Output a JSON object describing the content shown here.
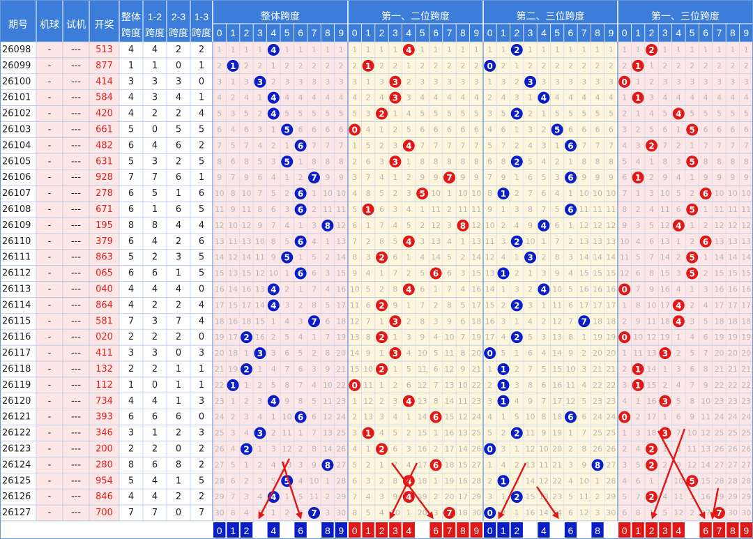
{
  "chart_data": {
    "type": "table",
    "headers": {
      "period": "期号",
      "machine": "机球",
      "trial": "试机",
      "draw": "开奖",
      "overall_span_l1": "整体",
      "overall_span_l2": "跨度",
      "span12_l1": "1-2",
      "span12_l2": "跨度",
      "span23_l1": "2-3",
      "span23_l2": "跨度",
      "span13_l1": "1-3",
      "span13_l2": "跨度",
      "groups": [
        "整体跨度",
        "第一、二位跨度",
        "第二、三位跨度",
        "第一、三位跨度"
      ],
      "digits": [
        "0",
        "1",
        "2",
        "3",
        "4",
        "5",
        "6",
        "7",
        "8",
        "9"
      ]
    },
    "rows": [
      {
        "period": "26098",
        "machine": "-",
        "trial": "---",
        "draw": "513",
        "spans": [
          4,
          4,
          2,
          2
        ]
      },
      {
        "period": "26099",
        "machine": "-",
        "trial": "---",
        "draw": "877",
        "spans": [
          1,
          1,
          0,
          1
        ]
      },
      {
        "period": "26100",
        "machine": "-",
        "trial": "---",
        "draw": "414",
        "spans": [
          3,
          3,
          3,
          0
        ]
      },
      {
        "period": "26101",
        "machine": "-",
        "trial": "---",
        "draw": "584",
        "spans": [
          4,
          3,
          4,
          1
        ]
      },
      {
        "period": "26102",
        "machine": "-",
        "trial": "---",
        "draw": "420",
        "spans": [
          4,
          2,
          2,
          4
        ]
      },
      {
        "period": "26103",
        "machine": "-",
        "trial": "---",
        "draw": "661",
        "spans": [
          5,
          0,
          5,
          5
        ]
      },
      {
        "period": "26104",
        "machine": "-",
        "trial": "---",
        "draw": "482",
        "spans": [
          6,
          4,
          6,
          2
        ]
      },
      {
        "period": "26105",
        "machine": "-",
        "trial": "---",
        "draw": "631",
        "spans": [
          5,
          3,
          2,
          5
        ]
      },
      {
        "period": "26106",
        "machine": "-",
        "trial": "---",
        "draw": "928",
        "spans": [
          7,
          7,
          6,
          1
        ]
      },
      {
        "period": "26107",
        "machine": "-",
        "trial": "---",
        "draw": "278",
        "spans": [
          6,
          5,
          1,
          6
        ]
      },
      {
        "period": "26108",
        "machine": "-",
        "trial": "---",
        "draw": "671",
        "spans": [
          6,
          1,
          6,
          5
        ]
      },
      {
        "period": "26109",
        "machine": "-",
        "trial": "---",
        "draw": "195",
        "spans": [
          8,
          8,
          4,
          4
        ]
      },
      {
        "period": "26110",
        "machine": "-",
        "trial": "---",
        "draw": "379",
        "spans": [
          6,
          4,
          2,
          6
        ]
      },
      {
        "period": "26111",
        "machine": "-",
        "trial": "---",
        "draw": "863",
        "spans": [
          5,
          2,
          3,
          5
        ]
      },
      {
        "period": "26112",
        "machine": "-",
        "trial": "---",
        "draw": "065",
        "spans": [
          6,
          6,
          1,
          5
        ]
      },
      {
        "period": "26113",
        "machine": "-",
        "trial": "---",
        "draw": "040",
        "spans": [
          4,
          4,
          4,
          0
        ]
      },
      {
        "period": "26114",
        "machine": "-",
        "trial": "---",
        "draw": "864",
        "spans": [
          4,
          2,
          2,
          4
        ]
      },
      {
        "period": "26115",
        "machine": "-",
        "trial": "---",
        "draw": "581",
        "spans": [
          7,
          3,
          7,
          4
        ]
      },
      {
        "period": "26116",
        "machine": "-",
        "trial": "---",
        "draw": "020",
        "spans": [
          2,
          2,
          2,
          0
        ]
      },
      {
        "period": "26117",
        "machine": "-",
        "trial": "---",
        "draw": "411",
        "spans": [
          3,
          3,
          0,
          3
        ]
      },
      {
        "period": "26118",
        "machine": "-",
        "trial": "---",
        "draw": "132",
        "spans": [
          2,
          2,
          1,
          1
        ]
      },
      {
        "period": "26119",
        "machine": "-",
        "trial": "---",
        "draw": "112",
        "spans": [
          1,
          0,
          1,
          1
        ]
      },
      {
        "period": "26120",
        "machine": "-",
        "trial": "---",
        "draw": "734",
        "spans": [
          4,
          4,
          1,
          3
        ]
      },
      {
        "period": "26121",
        "machine": "-",
        "trial": "---",
        "draw": "393",
        "spans": [
          6,
          6,
          6,
          0
        ]
      },
      {
        "period": "26122",
        "machine": "-",
        "trial": "---",
        "draw": "346",
        "spans": [
          3,
          1,
          2,
          3
        ]
      },
      {
        "period": "26123",
        "machine": "-",
        "trial": "---",
        "draw": "200",
        "spans": [
          2,
          2,
          0,
          2
        ]
      },
      {
        "period": "26124",
        "machine": "-",
        "trial": "---",
        "draw": "280",
        "spans": [
          8,
          6,
          8,
          2
        ]
      },
      {
        "period": "26125",
        "machine": "-",
        "trial": "---",
        "draw": "954",
        "spans": [
          5,
          4,
          1,
          5
        ]
      },
      {
        "period": "26126",
        "machine": "-",
        "trial": "---",
        "draw": "846",
        "spans": [
          4,
          4,
          2,
          2
        ]
      },
      {
        "period": "26127",
        "machine": "-",
        "trial": "---",
        "draw": "700",
        "spans": [
          7,
          7,
          0,
          7
        ]
      }
    ],
    "miss_first_row": [
      [
        1,
        1,
        1,
        1,
        null,
        1,
        1,
        1,
        1,
        1
      ],
      [
        1,
        1,
        1,
        1,
        null,
        1,
        1,
        1,
        1,
        1
      ],
      [
        1,
        1,
        null,
        1,
        1,
        1,
        1,
        1,
        1,
        1
      ],
      [
        1,
        1,
        null,
        1,
        1,
        1,
        1,
        1,
        1,
        1
      ]
    ],
    "footer_highlight": [
      [
        0,
        1,
        2,
        4,
        6,
        8,
        9
      ],
      [
        0,
        1,
        2,
        3,
        4,
        6,
        7,
        8,
        9
      ],
      [
        0,
        1,
        2,
        4,
        6,
        8
      ],
      [
        0,
        1,
        2,
        3,
        4,
        6,
        7,
        8,
        9
      ]
    ],
    "colors": {
      "header_bg": "#3b7dd8",
      "blue_ball": "#0a1ec8",
      "red_ball": "#e01818",
      "left_bg": "#fde6e6",
      "grid_bg": "#fdfbe3",
      "draw_text": "#e02020",
      "arrow": "#e01818"
    }
  }
}
